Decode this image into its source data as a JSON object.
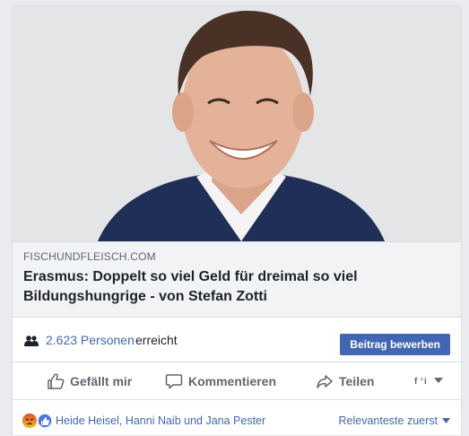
{
  "link": {
    "domain": "FISCHUNDFLEISCH.COM",
    "headline": "Erasmus: Doppelt so viel Geld für dreimal so viel Bildungshungrige - von Stefan Zotti"
  },
  "reach": {
    "count": "2.623 Personen",
    "label": "erreicht",
    "boost_button": "Beitrag bewerben"
  },
  "actions": {
    "like": "Gefällt mir",
    "comment": "Kommentieren",
    "share": "Teilen"
  },
  "reactions": {
    "names": "Heide Heisel, Hanni Naib und Jana Pester",
    "sort": "Relevanteste zuerst"
  },
  "colors": {
    "link_blue": "#4267b2",
    "text_dark": "#1d2129",
    "text_gray": "#606770"
  }
}
